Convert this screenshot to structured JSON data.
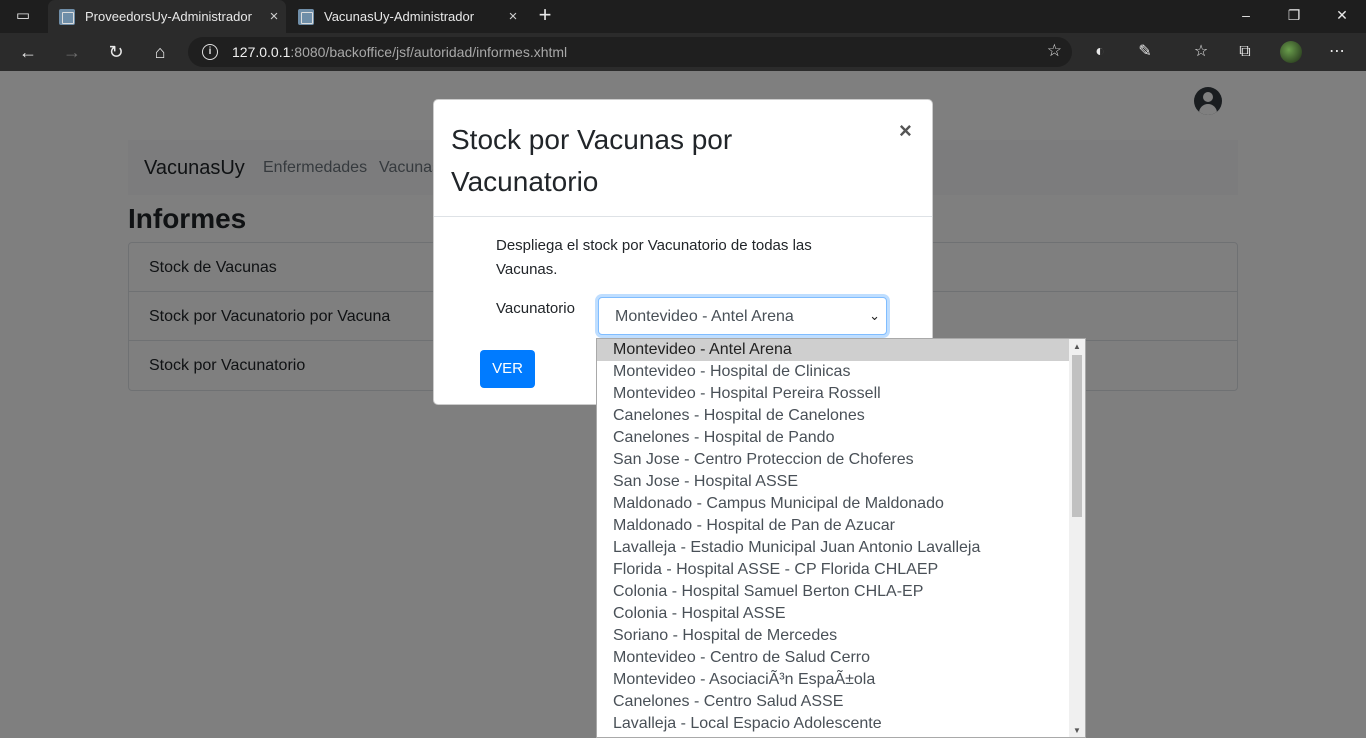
{
  "browser": {
    "tabs": [
      {
        "title": "ProveedorsUy-Administrador",
        "active": true
      },
      {
        "title": "VacunasUy-Administrador",
        "active": false
      }
    ],
    "url_host": "127.0.0.1",
    "url_rest": ":8080/backoffice/jsf/autoridad/informes.xhtml"
  },
  "app": {
    "brand": "VacunasUy",
    "nav": [
      "Enfermedades",
      "Vacunas"
    ],
    "heading": "Informes",
    "list": [
      "Stock de Vacunas",
      "Stock por Vacunatorio por Vacuna",
      "Stock por Vacunatorio"
    ]
  },
  "modal": {
    "title": "Stock por Vacunas por Vacunatorio",
    "close": "×",
    "description": "Despliega el stock por Vacunatorio de todas las Vacunas.",
    "field_label": "Vacunatorio",
    "selected": "Montevideo - Antel Arena",
    "button": "VER"
  },
  "dropdown_options": [
    "Montevideo - Antel Arena",
    "Montevideo - Hospital de Clinicas",
    "Montevideo - Hospital Pereira Rossell",
    "Canelones - Hospital de Canelones",
    "Canelones - Hospital de Pando",
    "San Jose - Centro Proteccion de Choferes",
    "San Jose - Hospital ASSE",
    "Maldonado - Campus Municipal de Maldonado",
    "Maldonado - Hospital de Pan de Azucar",
    "Lavalleja - Estadio Municipal Juan Antonio Lavalleja",
    "Florida - Hospital ASSE - CP Florida CHLAEP",
    "Colonia - Hospital Samuel Berton CHLA-EP",
    "Colonia - Hospital ASSE",
    "Soriano - Hospital de Mercedes",
    "Montevideo - Centro de Salud Cerro",
    "Montevideo - AsociaciÃ³n EspaÃ±ola",
    "Canelones - Centro Salud ASSE",
    "Lavalleja - Local Espacio Adolescente"
  ],
  "icons": {
    "tab_close": "×",
    "new_tab": "+",
    "minimize": "–",
    "restore": "❐",
    "win_close": "✕",
    "back": "←",
    "forward": "→",
    "reload": "↻",
    "home": "⌂",
    "info": "i",
    "fav_add": "☆",
    "favorites": "☆",
    "collections": "⧉",
    "more": "⋯",
    "select_arrow": "⌄",
    "scroll_up": "▲",
    "scroll_down": "▼"
  }
}
